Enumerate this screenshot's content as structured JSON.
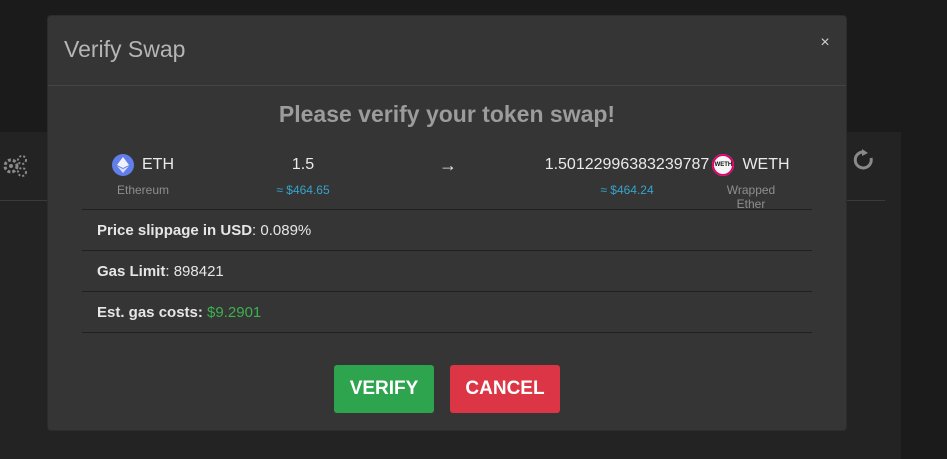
{
  "modal": {
    "title": "Verify Swap",
    "heading": "Please verify your token swap!",
    "close_symbol": "×"
  },
  "swap": {
    "from": {
      "symbol": "ETH",
      "name": "Ethereum",
      "amount": "1.5",
      "usd": "≈ $464.65",
      "icon": "ethereum-icon",
      "color": "#627eea"
    },
    "arrow": "→",
    "to": {
      "symbol": "WETH",
      "name": "Wrapped Ether",
      "amount": "1.50122996383239787",
      "usd": "≈ $464.24",
      "icon": "weth-icon",
      "icon_text": "WETH"
    }
  },
  "details": {
    "slippage_label": "Price slippage in USD",
    "slippage_value": ": 0.089%",
    "gas_limit_label": "Gas Limit",
    "gas_limit_value": ": 898421",
    "gas_cost_label": "Est. gas costs:",
    "gas_cost_value": "$9.2901"
  },
  "buttons": {
    "verify": "VERIFY",
    "cancel": "CANCEL"
  },
  "colors": {
    "verify": "#2ea44f",
    "cancel": "#dc3545",
    "usd_accent": "#36a3c9",
    "gas_cost": "#3cb04f"
  }
}
